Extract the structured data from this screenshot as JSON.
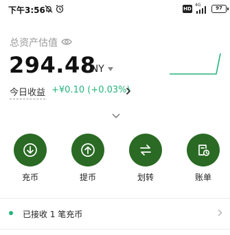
{
  "status_bar": {
    "time": "下午3:56",
    "hd": "HD",
    "network": "4G",
    "battery": "97"
  },
  "asset": {
    "label": "总资产估值",
    "value": "294.48",
    "currency": "CNY"
  },
  "pnl": {
    "label": "今日收益",
    "value": "+¥0.10 (+0.03%)"
  },
  "actions": [
    {
      "label": "充币",
      "icon": "download-icon"
    },
    {
      "label": "提币",
      "icon": "upload-icon"
    },
    {
      "label": "划转",
      "icon": "transfer-icon"
    },
    {
      "label": "账单",
      "icon": "bill-icon"
    }
  ],
  "notice": {
    "text": "已接收 1 笔充币"
  },
  "colors": {
    "accent_green": "#24b37b",
    "button_green": "#2a6a24"
  }
}
